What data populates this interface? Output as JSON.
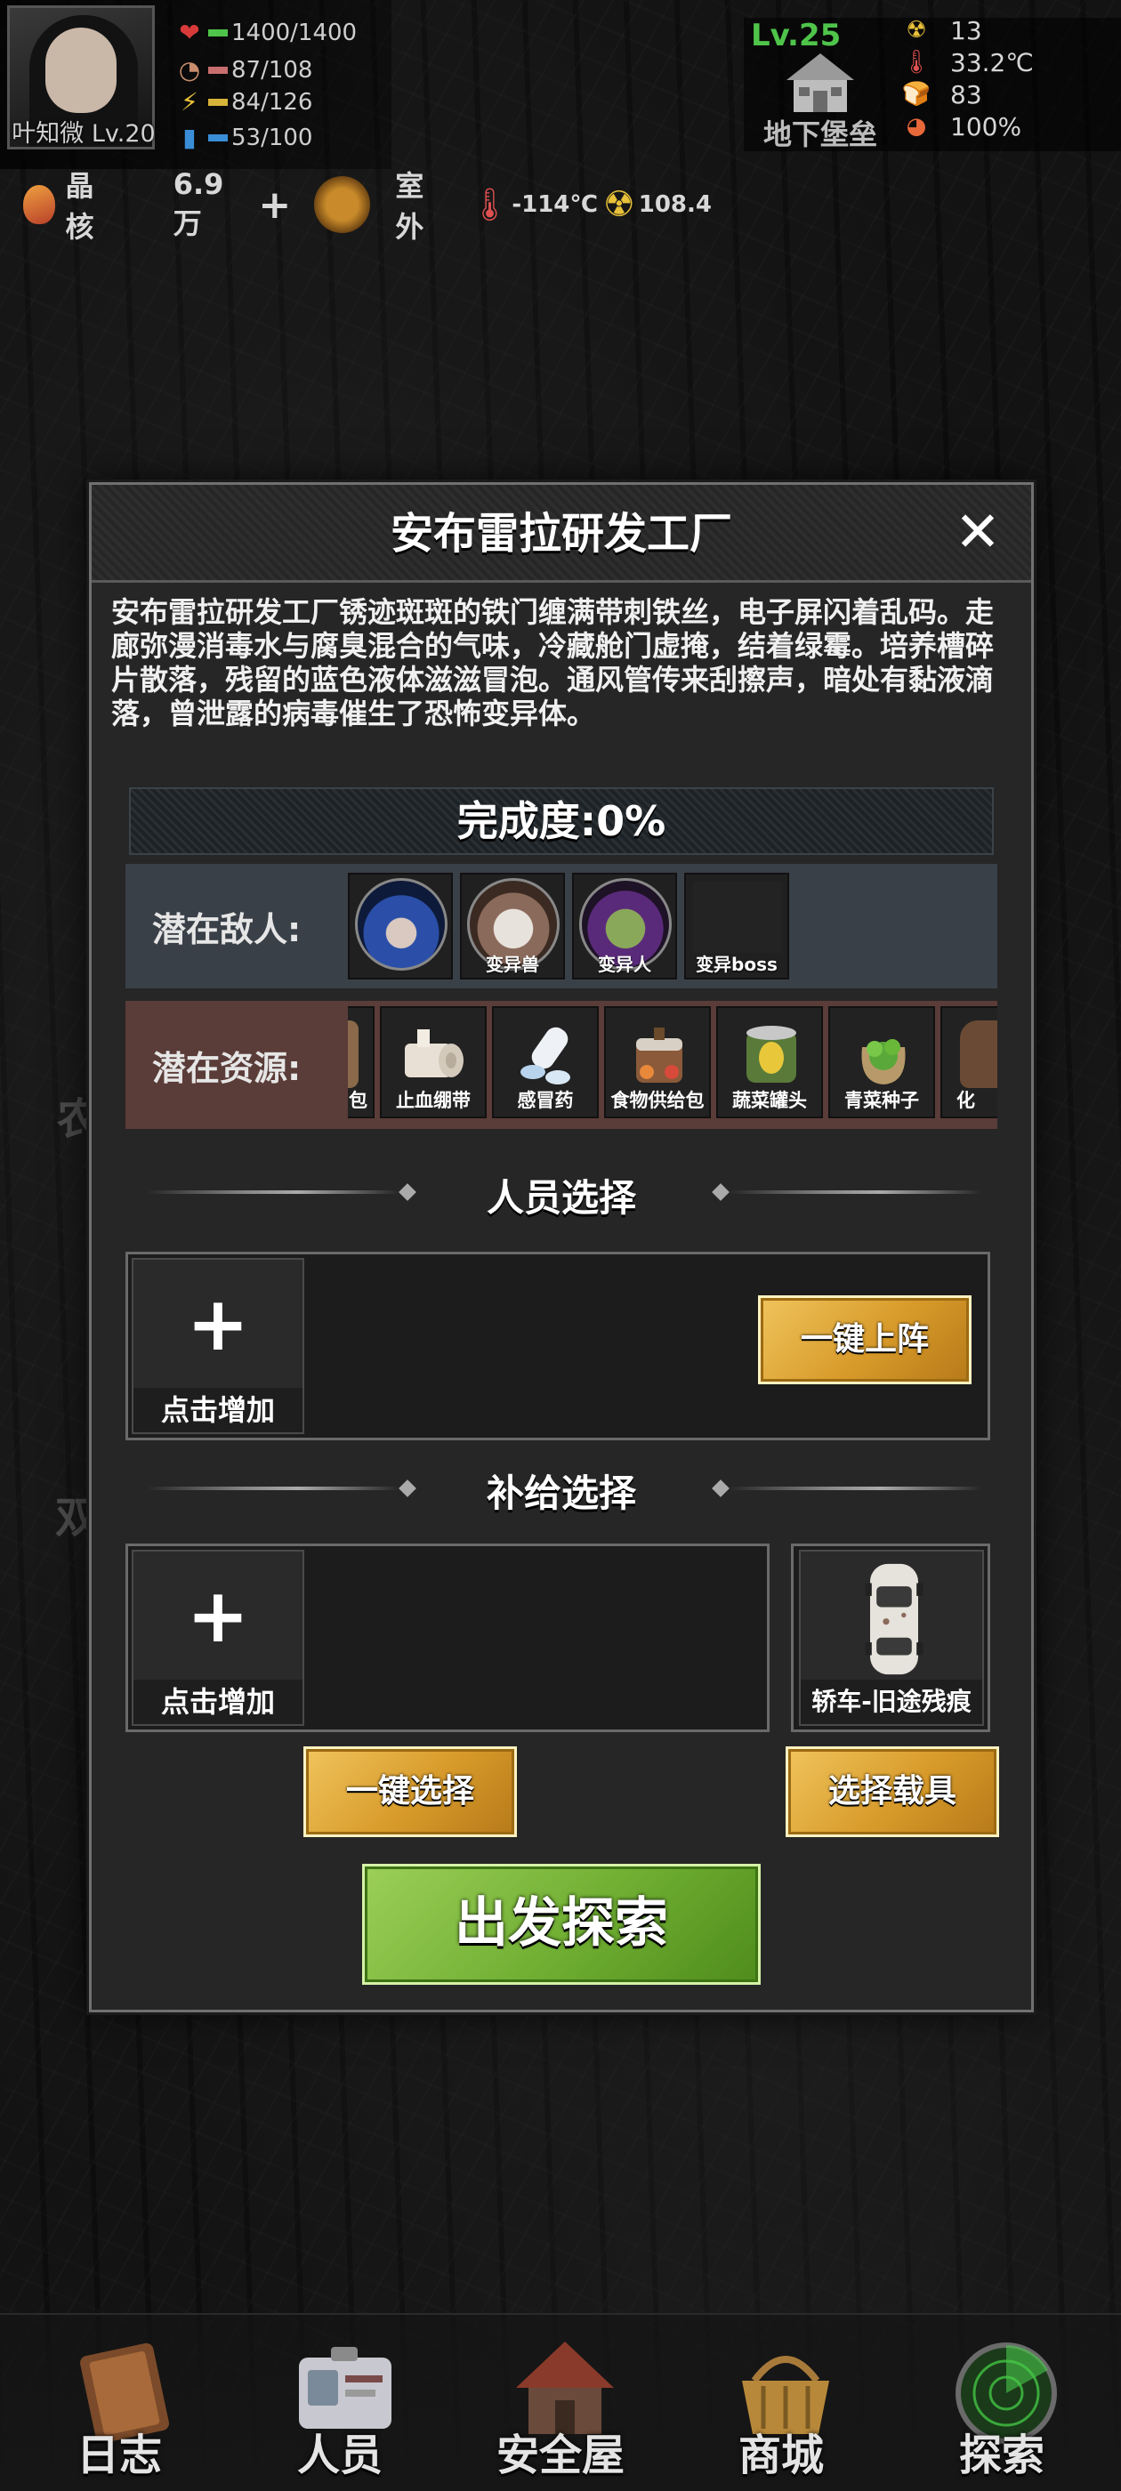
{
  "player": {
    "name_level": "叶知微 Lv.20",
    "stats": [
      {
        "icon": "heart-icon",
        "value": "1400/1400",
        "color": "#d83a3a"
      },
      {
        "icon": "hunger-icon",
        "value": "87/108",
        "color": "#c96e6e"
      },
      {
        "icon": "energy-icon",
        "value": "84/126",
        "color": "#d8b33a"
      },
      {
        "icon": "water-icon",
        "value": "53/100",
        "color": "#3a8ed8"
      }
    ]
  },
  "resources": {
    "crystal_label": "晶核",
    "crystal_amount": "6.9万",
    "location": "室外",
    "temperature": "-114℃",
    "radiation": "108.4"
  },
  "base": {
    "level": "Lv.25",
    "name": "地下堡垒",
    "radiation": "13",
    "temperature": "33.2℃",
    "food": "83",
    "power": "100%"
  },
  "modal": {
    "title": "安布雷拉研发工厂",
    "description": "安布雷拉研发工厂锈迹斑斑的铁门缠满带刺铁丝，电子屏闪着乱码。走廊弥漫消毒水与腐臭混合的气味，冷藏舱门虚掩，结着绿霉。培养槽碎片散落，残留的蓝色液体滋滋冒泡。通风管传来刮擦声，暗处有黏液滴落，曾泄露的病毒催生了恐怖变异体。",
    "progress": "完成度:0%",
    "enemies_label": "潜在敌人:",
    "enemies": [
      {
        "name": "",
        "icon": "blue-hair-zombie-icon"
      },
      {
        "name": "变异兽",
        "icon": "mutant-wolf-icon"
      },
      {
        "name": "变异人",
        "icon": "mutant-human-icon"
      },
      {
        "name": "变异boss",
        "icon": "mutant-boss-icon"
      }
    ],
    "resources_label": "潜在资源:",
    "resources": [
      {
        "name": "包",
        "icon": "bag-icon"
      },
      {
        "name": "止血绷带",
        "icon": "bandage-icon"
      },
      {
        "name": "感冒药",
        "icon": "pills-icon"
      },
      {
        "name": "食物供给包",
        "icon": "food-pack-icon"
      },
      {
        "name": "蔬菜罐头",
        "icon": "canned-veg-icon"
      },
      {
        "name": "青菜种子",
        "icon": "seed-bag-icon"
      },
      {
        "name": "化",
        "icon": "sack-icon"
      }
    ],
    "personnel_title": "人员选择",
    "add_label": "点击增加",
    "auto_deploy": "一键上阵",
    "supply_title": "补给选择",
    "auto_select": "一键选择",
    "vehicle_name": "轿车-旧途残痕",
    "select_vehicle": "选择载具",
    "depart": "出发探索"
  },
  "map_labels": [
    "农",
    "双"
  ],
  "nav": [
    {
      "label": "日志",
      "icon": "journal-icon"
    },
    {
      "label": "人员",
      "icon": "id-card-icon"
    },
    {
      "label": "安全屋",
      "icon": "house-icon"
    },
    {
      "label": "商城",
      "icon": "basket-icon"
    },
    {
      "label": "探索",
      "icon": "radar-icon"
    }
  ]
}
